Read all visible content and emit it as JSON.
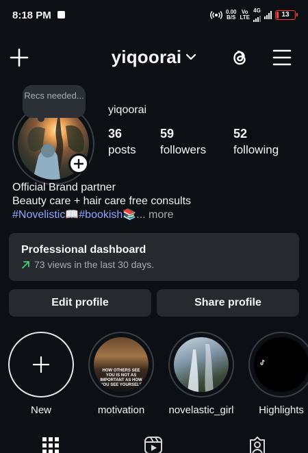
{
  "status_bar": {
    "time": "8:18 PM",
    "speed_value": "0.00",
    "speed_unit": "B/S",
    "volte_top": "Vo",
    "volte_bottom": "LTE",
    "network": "4G",
    "battery": "13"
  },
  "header": {
    "username": "yiqoorai",
    "icons": [
      "plus-icon",
      "chevron-down-icon",
      "threads-icon",
      "menu-icon"
    ]
  },
  "profile": {
    "note": "Recs needed...",
    "name": "yiqoorai",
    "stats": [
      {
        "value": "36",
        "label": "posts"
      },
      {
        "value": "59",
        "label": "followers"
      },
      {
        "value": "52",
        "label": "following"
      }
    ],
    "bio_lines": [
      "Official Brand partner",
      "Beauty care + hair care free consults"
    ],
    "tag1": "#Novelistic📖",
    "tag2": "#bookish📚",
    "more": "... more"
  },
  "dashboard": {
    "title": "Professional dashboard",
    "subtitle": "73 views in the last 30 days."
  },
  "buttons": {
    "edit": "Edit profile",
    "share": "Share profile"
  },
  "highlights": [
    {
      "label": "New"
    },
    {
      "label": "motivation",
      "text": "HOW OTHERS SEE YOU IS NOT AS IMPORTANT AS HOW YOU SEE YOURSELF"
    },
    {
      "label": "novelastic_girl"
    },
    {
      "label": "Highlights"
    }
  ],
  "colors": {
    "background": "#0c1014",
    "card": "#262a2f",
    "link": "#8fa6ff",
    "trend": "#3ecf6e",
    "battery_low": "#ff3b3b"
  }
}
